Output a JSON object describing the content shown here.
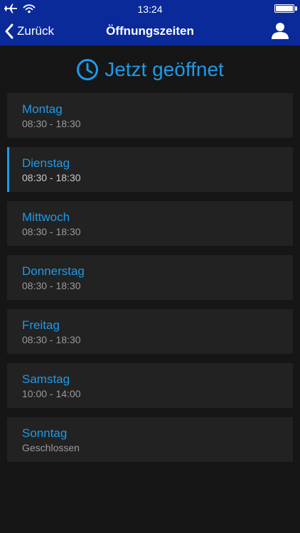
{
  "status_bar": {
    "time": "13:24"
  },
  "nav": {
    "back_label": "Zurück",
    "title": "Öffnungszeiten"
  },
  "open_status": {
    "label": "Jetzt geöffnet"
  },
  "days": [
    {
      "name": "Montag",
      "hours": "08:30 - 18:30",
      "active": false
    },
    {
      "name": "Dienstag",
      "hours": "08:30 - 18:30",
      "active": true
    },
    {
      "name": "Mittwoch",
      "hours": "08:30 - 18:30",
      "active": false
    },
    {
      "name": "Donnerstag",
      "hours": "08:30 - 18:30",
      "active": false
    },
    {
      "name": "Freitag",
      "hours": "08:30 - 18:30",
      "active": false
    },
    {
      "name": "Samstag",
      "hours": "10:00 - 14:00",
      "active": false
    },
    {
      "name": "Sonntag",
      "hours": "Geschlossen",
      "active": false
    }
  ],
  "colors": {
    "nav_background": "#0a2a9a",
    "accent": "#1e9ae8",
    "background": "#161616",
    "card": "#222222"
  },
  "icons": {
    "status_left": [
      "airplane-icon",
      "wifi-icon"
    ],
    "status_right": "battery-icon",
    "back": "chevron-left-icon",
    "profile": "person-icon",
    "open_status": "clock-icon"
  }
}
